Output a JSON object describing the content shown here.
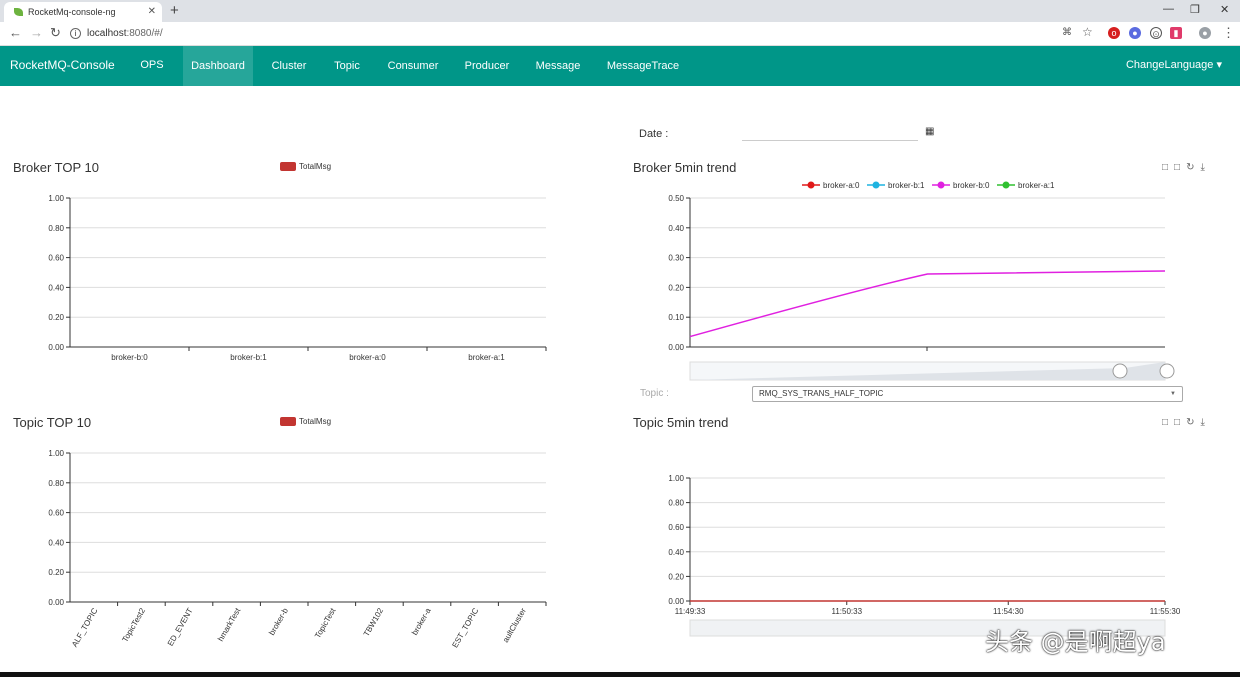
{
  "browser": {
    "tab_title": "RocketMq-console-ng",
    "tab_close": "✕",
    "new_tab": "+",
    "url_host": "localhost",
    "url_path": ":8080/#/",
    "window_controls": [
      "—",
      "❐",
      "✕"
    ]
  },
  "navbar": {
    "brand": "RocketMQ-Console",
    "items": [
      "OPS",
      "Dashboard",
      "Cluster",
      "Topic",
      "Consumer",
      "Producer",
      "Message",
      "MessageTrace"
    ],
    "active": "Dashboard",
    "language": "ChangeLanguage ▾",
    "accent": "#009688"
  },
  "date": {
    "label": "Date :",
    "value": ""
  },
  "topic_filter": {
    "label": "Topic :",
    "selected": "RMQ_SYS_TRANS_HALF_TOPIC"
  },
  "watermark": "头条 @是啊超ya",
  "chart_data": [
    {
      "type": "bar",
      "title": "Broker TOP 10",
      "legend": [
        "TotalMsg"
      ],
      "categories": [
        "broker-b:0",
        "broker-b:1",
        "broker-a:0",
        "broker-a:1"
      ],
      "series": [
        {
          "name": "TotalMsg",
          "values": [
            0,
            0,
            0,
            0
          ],
          "color": "#c23531"
        }
      ],
      "ylim": [
        0,
        1
      ],
      "yticks": [
        "0.00",
        "0.20",
        "0.40",
        "0.60",
        "0.80",
        "1.00"
      ],
      "grid": true,
      "legend_position": "top-center"
    },
    {
      "type": "line",
      "title": "Broker 5min trend",
      "legend": [
        "broker-a:0",
        "broker-b:1",
        "broker-b:0",
        "broker-a:1"
      ],
      "series": [
        {
          "name": "broker-a:0",
          "color": "#e01818",
          "values": []
        },
        {
          "name": "broker-b:1",
          "color": "#1fb3e0",
          "values": []
        },
        {
          "name": "broker-b:0",
          "color": "#e020e0",
          "values": [
            0.035,
            0.245,
            0.255
          ]
        },
        {
          "name": "broker-a:1",
          "color": "#30c030",
          "values": []
        }
      ],
      "ylim": [
        0,
        0.5
      ],
      "yticks": [
        "0.00",
        "0.10",
        "0.20",
        "0.30",
        "0.40",
        "0.50"
      ],
      "grid": true,
      "legend_position": "top-center",
      "toolbox": [
        "□",
        "□",
        "↻",
        "⤓"
      ]
    },
    {
      "type": "bar",
      "title": "Topic TOP 10",
      "legend": [
        "TotalMsg"
      ],
      "categories": [
        "ALF_TOPIC",
        "TopicTest2",
        "ED_EVENT",
        "hmarkTest",
        "broker-b",
        "TopicTest",
        "TBW102",
        "broker-a",
        "EST_TOPIC",
        "aultCluster"
      ],
      "series": [
        {
          "name": "TotalMsg",
          "values": [
            0,
            0,
            0,
            0,
            0,
            0,
            0,
            0,
            0,
            0
          ],
          "color": "#c23531"
        }
      ],
      "ylim": [
        0,
        1
      ],
      "yticks": [
        "0.00",
        "0.20",
        "0.40",
        "0.60",
        "0.80",
        "1.00"
      ],
      "grid": true,
      "legend_position": "top-center"
    },
    {
      "type": "line",
      "title": "Topic 5min trend",
      "x": [
        "11:49:33",
        "11:50:33",
        "11:54:30",
        "11:55:30"
      ],
      "series": [
        {
          "values": [
            0,
            0,
            0,
            0
          ],
          "color": "#c23531"
        }
      ],
      "ylim": [
        0,
        1
      ],
      "yticks": [
        "0.00",
        "0.20",
        "0.40",
        "0.60",
        "0.80",
        "1.00"
      ],
      "grid": true,
      "toolbox": [
        "□",
        "□",
        "↻",
        "⤓"
      ]
    }
  ]
}
